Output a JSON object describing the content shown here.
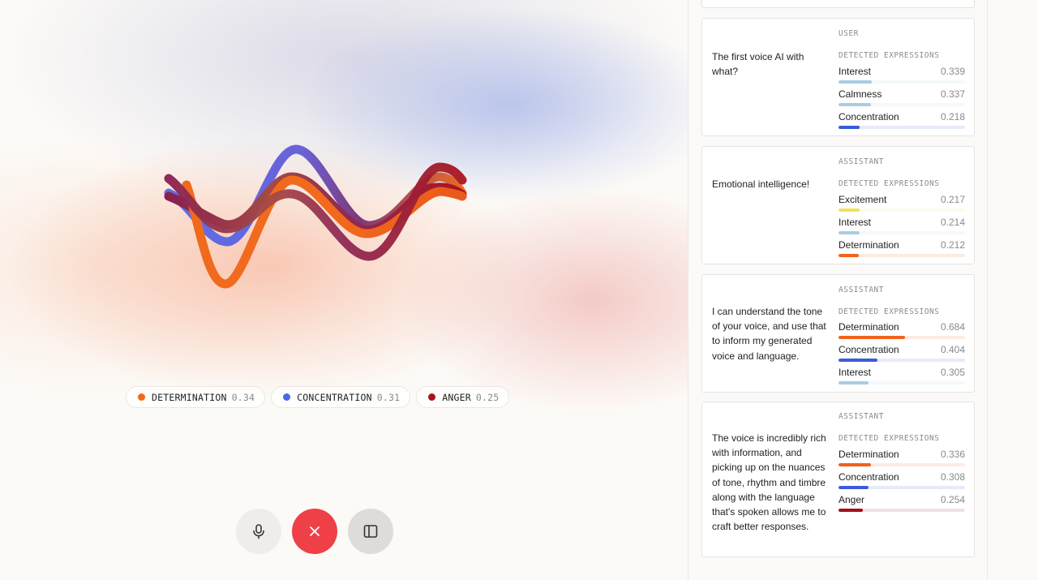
{
  "chips": [
    {
      "label": "DETERMINATION",
      "score": "0.34",
      "color": "#f06a1e"
    },
    {
      "label": "CONCENTRATION",
      "score": "0.31",
      "color": "#4a68e8"
    },
    {
      "label": "ANGER",
      "score": "0.25",
      "color": "#a61522"
    }
  ],
  "controls": {
    "mic_icon": "microphone-icon",
    "end_icon": "close-icon",
    "panel_icon": "sidebar-toggle-icon"
  },
  "colors": {
    "Determination": "#f0621d",
    "Concentration": "#3b5bdb",
    "Interest": "#a9cde3",
    "Calmness": "#a8cde0",
    "Excitement": "#f1e15a",
    "Anger": "#a3101c",
    "end_button": "#ef4048"
  },
  "messages": [
    {
      "role": "USER",
      "detected_label": "DETECTED EXPRESSIONS",
      "text": "The first voice AI with what?",
      "expressions": [
        {
          "name": "Interest",
          "score": "0.339",
          "value": 0.339
        },
        {
          "name": "Calmness",
          "score": "0.337",
          "value": 0.337
        },
        {
          "name": "Concentration",
          "score": "0.218",
          "value": 0.218
        }
      ]
    },
    {
      "role": "ASSISTANT",
      "detected_label": "DETECTED EXPRESSIONS",
      "text": "Emotional intelligence!",
      "expressions": [
        {
          "name": "Excitement",
          "score": "0.217",
          "value": 0.217
        },
        {
          "name": "Interest",
          "score": "0.214",
          "value": 0.214
        },
        {
          "name": "Determination",
          "score": "0.212",
          "value": 0.212
        }
      ]
    },
    {
      "role": "ASSISTANT",
      "detected_label": "DETECTED EXPRESSIONS",
      "text": "I can understand the tone of your voice, and use that to inform my generated voice and language.",
      "expressions": [
        {
          "name": "Determination",
          "score": "0.684",
          "value": 0.684
        },
        {
          "name": "Concentration",
          "score": "0.404",
          "value": 0.404
        },
        {
          "name": "Interest",
          "score": "0.305",
          "value": 0.305
        }
      ]
    },
    {
      "role": "ASSISTANT",
      "detected_label": "DETECTED EXPRESSIONS",
      "text": "The voice is incredibly rich with information, and picking up on the nuances of tone, rhythm and timbre along with the language that's spoken allows me to craft better responses.",
      "expressions": [
        {
          "name": "Determination",
          "score": "0.336",
          "value": 0.336
        },
        {
          "name": "Concentration",
          "score": "0.308",
          "value": 0.308
        },
        {
          "name": "Anger",
          "score": "0.254",
          "value": 0.254
        }
      ]
    }
  ]
}
